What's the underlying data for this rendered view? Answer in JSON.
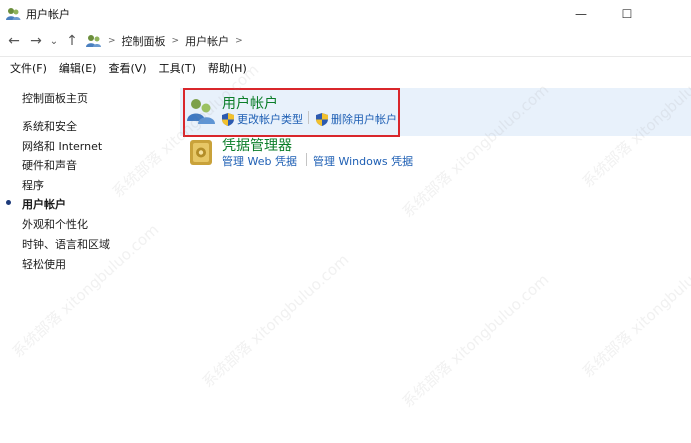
{
  "window": {
    "title": "用户帐户",
    "controls": {
      "minimize": "—",
      "maximize": "☐"
    }
  },
  "navigation": {
    "back_icon": "←",
    "forward_icon": "→",
    "recent_icon": "⌄",
    "up_icon": "↑",
    "breadcrumb": [
      "控制面板",
      "用户帐户"
    ],
    "separator": ">"
  },
  "menubar": {
    "items": [
      "文件(F)",
      "编辑(E)",
      "查看(V)",
      "工具(T)",
      "帮助(H)"
    ]
  },
  "sidebar": {
    "home": "控制面板主页",
    "categories": [
      "系统和安全",
      "网络和 Internet",
      "硬件和声音",
      "程序",
      "用户帐户",
      "外观和个性化",
      "时钟、语言和区域",
      "轻松使用"
    ],
    "active_index": 4
  },
  "main": {
    "user_accounts": {
      "title": "用户帐户",
      "links": [
        "更改帐户类型",
        "删除用户帐户"
      ]
    },
    "credential_manager": {
      "title": "凭据管理器",
      "links": [
        "管理 Web 凭据",
        "管理 Windows 凭据"
      ]
    }
  },
  "watermark": "系统部落 xitongbuluo.com",
  "colors": {
    "heading_green": "#0a7d28",
    "link_blue": "#1e5fb4",
    "highlight_bg": "#e8f1fb",
    "annotation_red": "#d9262b"
  }
}
